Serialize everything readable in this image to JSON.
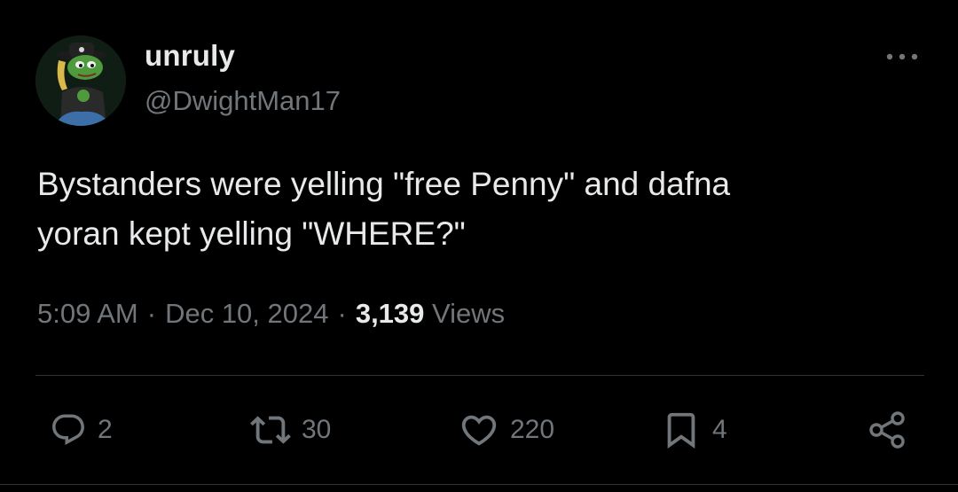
{
  "author": {
    "display_name": "unruly",
    "handle": "@DwightMan17",
    "avatar_icon": "frog-cowboy-avatar"
  },
  "tweet": {
    "text": "Bystanders were yelling \"free Penny\" and dafna\nyoran kept yelling \"WHERE?\""
  },
  "meta": {
    "time": "5:09 AM",
    "separator": "·",
    "date": "Dec 10, 2024",
    "views_count": "3,139",
    "views_label": "Views"
  },
  "actions": {
    "replies": "2",
    "reposts": "30",
    "likes": "220",
    "bookmarks": "4"
  },
  "colors": {
    "background": "#000000",
    "primary_text": "#e7e9ea",
    "secondary_text": "#71767b",
    "divider": "#2f3336"
  }
}
